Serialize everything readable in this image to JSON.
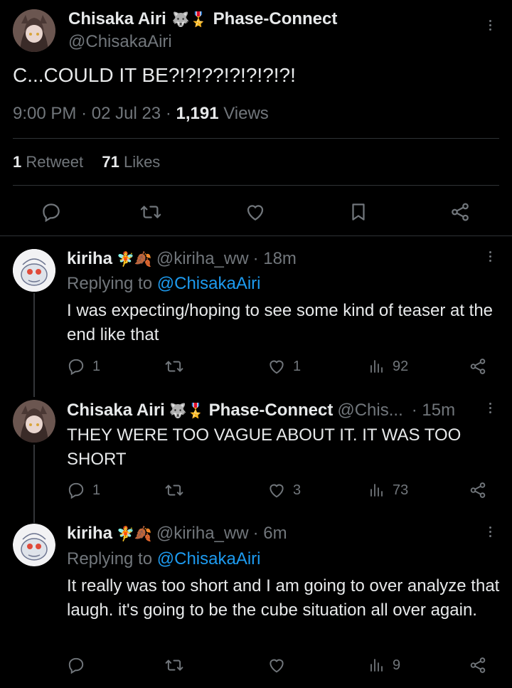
{
  "main_tweet": {
    "author_name": "Chisaka Airi",
    "author_emoji": "🐺🎖️",
    "author_affiliation": "Phase-Connect",
    "handle": "@ChisakaAiri",
    "text": "C...COULD IT BE?!?!??!?!?!?!?!",
    "time": "9:00 PM",
    "sep": "·",
    "date": "02 Jul 23",
    "views_count": "1,191",
    "views_label": "Views",
    "retweets_count": "1",
    "retweets_label": "Retweet",
    "likes_count": "71",
    "likes_label": "Likes"
  },
  "replies": [
    {
      "author_name": "kiriha",
      "author_emoji": "🧚🍂",
      "handle": "@kiriha_ww",
      "time": "· 18m",
      "replying_label": "Replying to",
      "replying_to": "@ChisakaAiri",
      "text": "I was expecting/hoping to see some kind of teaser at the end like that",
      "replies": "1",
      "retweets": "",
      "likes": "1",
      "views": "92"
    },
    {
      "author_name": "Chisaka Airi",
      "author_emoji": "🐺🎖️",
      "author_affiliation": "Phase-Connect",
      "handle": "@Chis...",
      "time": "· 15m",
      "text": "THEY WERE TOO VAGUE ABOUT IT. IT WAS TOO SHORT",
      "replies": "1",
      "retweets": "",
      "likes": "3",
      "views": "73"
    },
    {
      "author_name": "kiriha",
      "author_emoji": "🧚🍂",
      "handle": "@kiriha_ww",
      "time": "· 6m",
      "replying_label": "Replying to",
      "replying_to": "@ChisakaAiri",
      "text": "It really was too short and I am going to over analyze that laugh. it's going to be the cube situation all over again.",
      "replies": "",
      "retweets": "",
      "likes": "",
      "views": "9"
    }
  ],
  "icons": {
    "reply": "reply-icon",
    "retweet": "retweet-icon",
    "like": "heart-icon",
    "bookmark": "bookmark-icon",
    "share": "share-icon",
    "views": "views-icon",
    "more": "more-icon"
  },
  "colors": {
    "background": "#000000",
    "text": "#e7e9ea",
    "muted": "#71767b",
    "link": "#1d9bf0",
    "divider": "#2f3336"
  }
}
